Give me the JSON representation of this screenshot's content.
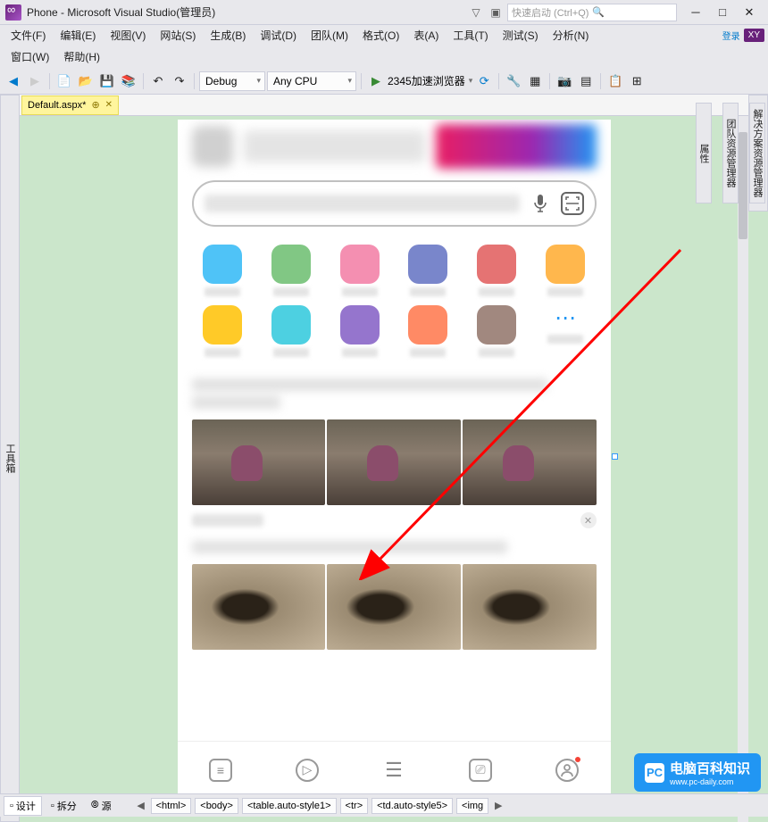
{
  "titlebar": {
    "title": "Phone - Microsoft Visual Studio(管理员)",
    "search_placeholder": "快速启动 (Ctrl+Q)",
    "signin": "登录",
    "user_badge": "XY"
  },
  "menu": [
    "文件(F)",
    "编辑(E)",
    "视图(V)",
    "网站(S)",
    "生成(B)",
    "调试(D)",
    "团队(M)",
    "格式(O)",
    "表(A)",
    "工具(T)",
    "测试(S)",
    "分析(N)",
    "窗口(W)",
    "帮助(H)"
  ],
  "toolbar": {
    "config": "Debug",
    "platform": "Any CPU",
    "run_label": "2345加速浏览器"
  },
  "tab": {
    "name": "Default.aspx*",
    "pinned": "⊕"
  },
  "side_left": "工具箱",
  "side_right": [
    "解决方案资源管理器",
    "团队资源管理器",
    "属性"
  ],
  "viewmodes": {
    "design": "设计",
    "split": "拆分",
    "source": "源"
  },
  "breadcrumbs": [
    "<html>",
    "<body>",
    "<table.auto-style1>",
    "<tr>",
    "<td.auto-style5>",
    "<img"
  ],
  "icons": {
    "back": "◀",
    "fwd": "▶",
    "new": "📄",
    "open": "📂",
    "save": "💾",
    "saveall": "📚",
    "undo": "↶",
    "redo": "↷",
    "play": "▶",
    "refresh": "⟳",
    "mic": "🎤",
    "scan": "⊡",
    "more": "⋯",
    "nav_feed": "≡",
    "nav_video": "▷",
    "nav_menu": "☰",
    "nav_tool": "⎚",
    "nav_me": "👤",
    "close": "✕",
    "dropdown": "▾",
    "nav_left": "◀",
    "nav_right": "▶",
    "search_mag": "🔍",
    "filter": "▽",
    "notif": "▣",
    "min": "─",
    "max": "□"
  },
  "app_colors": [
    "#4fc3f7",
    "#81c784",
    "#f48fb1",
    "#7986cb",
    "#e57373",
    "#ffb74d",
    "#ffca28",
    "#4dd0e1",
    "#9575cd",
    "#ff8a65",
    "#a1887f"
  ],
  "watermark": {
    "brand": "电脑百科知识",
    "url": "www.pc-daily.com"
  }
}
